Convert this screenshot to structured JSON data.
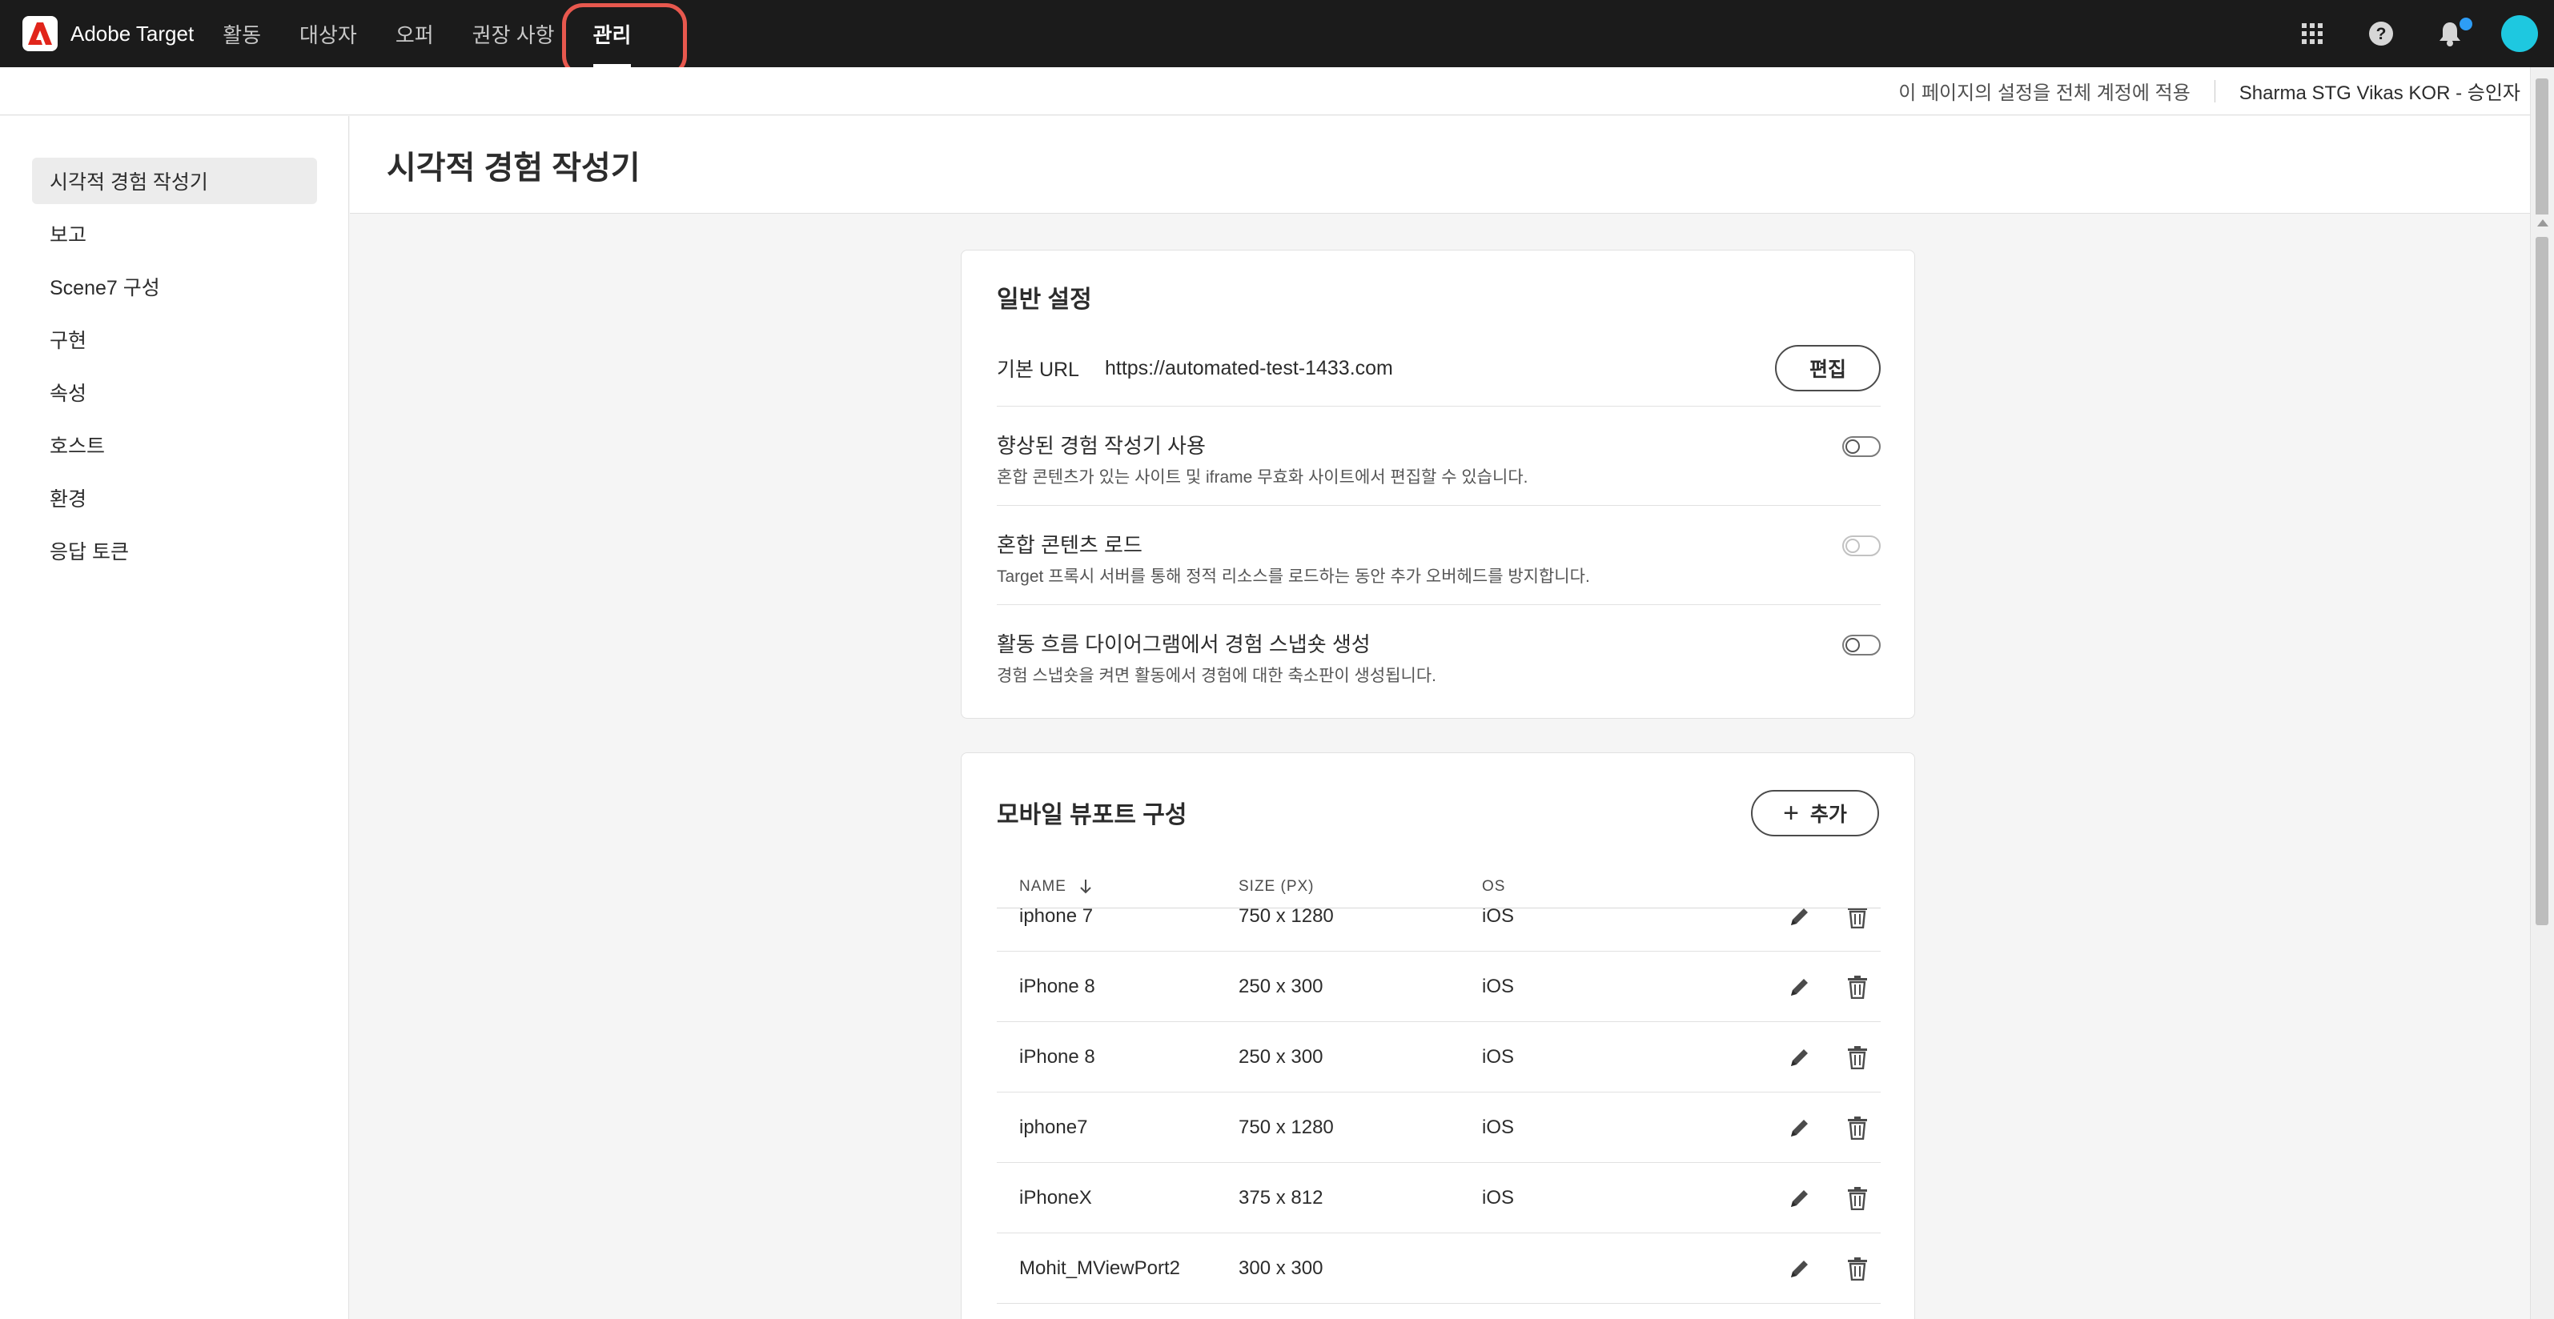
{
  "app": {
    "name": "Adobe Target"
  },
  "topnav": {
    "items": [
      {
        "label": "활동"
      },
      {
        "label": "대상자"
      },
      {
        "label": "오퍼"
      },
      {
        "label": "권장 사항"
      },
      {
        "label": "관리",
        "active": true
      }
    ],
    "icons": [
      "apps-grid-icon",
      "help-icon",
      "notifications-icon",
      "user-avatar"
    ]
  },
  "subheader": {
    "apply_all_link": "이 페이지의 설정을 전체 계정에 적용",
    "user": "Sharma STG Vikas KOR - 승인자"
  },
  "sidebar": {
    "items": [
      {
        "label": "시각적 경험 작성기",
        "selected": true
      },
      {
        "label": "보고"
      },
      {
        "label": "Scene7 구성"
      },
      {
        "label": "구현"
      },
      {
        "label": "속성"
      },
      {
        "label": "호스트"
      },
      {
        "label": "환경"
      },
      {
        "label": "응답 토큰"
      }
    ]
  },
  "page": {
    "title": "시각적 경험 작성기"
  },
  "general": {
    "title": "일반 설정",
    "base_url_label": "기본 URL",
    "base_url_value": "https://automated-test-1433.com",
    "edit_label": "편집",
    "settings": [
      {
        "title": "향상된 경험 작성기 사용",
        "desc": "혼합 콘텐츠가 있는 사이트 및 iframe 무효화 사이트에서 편집할 수 있습니다.",
        "on": false,
        "disabled": false
      },
      {
        "title": "혼합 콘텐츠 로드",
        "desc": "Target 프록시 서버를 통해 정적 리소스를 로드하는 동안 추가 오버헤드를 방지합니다.",
        "on": false,
        "disabled": true
      },
      {
        "title": "활동 흐름 다이어그램에서 경험 스냅숏 생성",
        "desc": "경험 스냅숏을 켜면 활동에서 경험에 대한 축소판이 생성됩니다.",
        "on": false,
        "disabled": false
      }
    ]
  },
  "mobile": {
    "title": "모바일 뷰포트 구성",
    "add_label": "추가",
    "columns": {
      "name": "NAME",
      "size": "SIZE (PX)",
      "os": "OS"
    },
    "rows": [
      {
        "name": "iphone 7",
        "size": "750 x 1280",
        "os": "iOS"
      },
      {
        "name": "iPhone 8",
        "size": "250 x 300",
        "os": "iOS"
      },
      {
        "name": "iPhone 8",
        "size": "250 x 300",
        "os": "iOS"
      },
      {
        "name": "iphone7",
        "size": "750 x 1280",
        "os": "iOS"
      },
      {
        "name": "iPhoneX",
        "size": "375 x 812",
        "os": "iOS"
      },
      {
        "name": "Mohit_MViewPort2",
        "size": "300 x 300",
        "os": ""
      },
      {
        "name": "",
        "size": "",
        "os": ""
      }
    ]
  }
}
